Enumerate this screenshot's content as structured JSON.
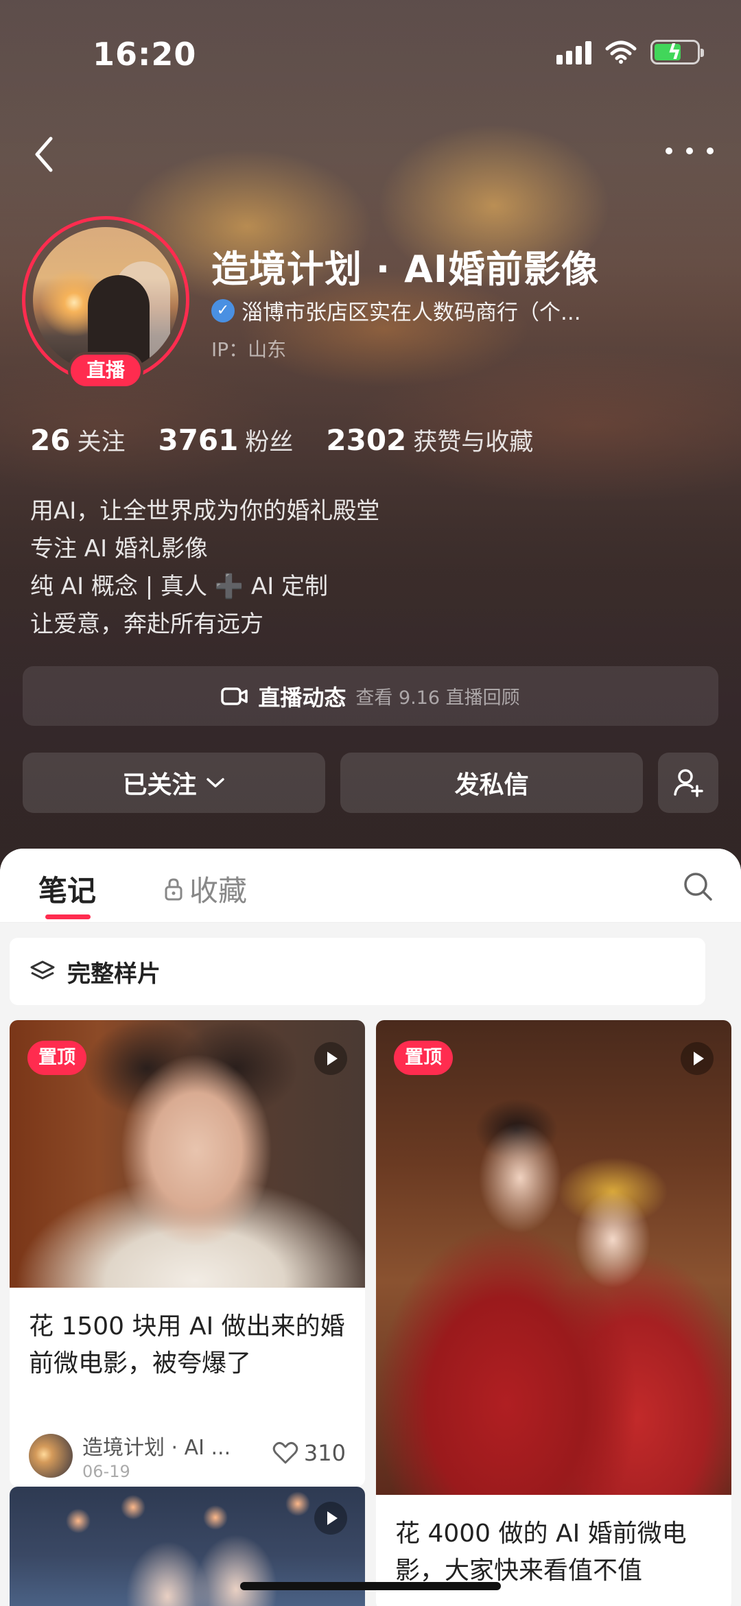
{
  "status_bar": {
    "time": "16:20"
  },
  "profile": {
    "name": "造境计划 · AI婚前影像",
    "verification": "淄博市张店区实在人数码商行（个...",
    "ip": "IP：山东",
    "live_badge": "直播",
    "stats": [
      {
        "num": "26",
        "label": "关注"
      },
      {
        "num": "3761",
        "label": "粉丝"
      },
      {
        "num": "2302",
        "label": "获赞与收藏"
      }
    ],
    "bio": [
      "用AI，让全世界成为你的婚礼殿堂",
      "专注 AI 婚礼影像",
      "纯 AI 概念 | 真人",
      "AI 定制",
      "让爱意，奔赴所有远方"
    ],
    "bio_cross": "➕"
  },
  "live_panel": {
    "title": "直播动态",
    "subtitle": "查看 9.16 直播回顾"
  },
  "actions": {
    "follow": "已关注",
    "message": "发私信"
  },
  "tabs": {
    "notes": "笔记",
    "favorites": "收藏"
  },
  "collection": {
    "label": "完整样片"
  },
  "cards": [
    {
      "pin": "置顶",
      "title_lines": [
        "花 1500 块用 AI 做出来的婚",
        "前微电影，被夸爆了"
      ],
      "author": "造境计划 · AI ...",
      "date": "06-19",
      "likes": "310"
    },
    {
      "pin": "置顶",
      "title_lines": [
        "花 4000 做的 AI 婚前微电",
        "影，大家快来看值不值"
      ]
    }
  ],
  "colors": {
    "accent": "#ff2c4f",
    "verify_blue": "#4a90e2"
  },
  "icons": [
    "back-icon",
    "more-icon",
    "verified-icon",
    "video-camera-icon",
    "chevron-down-icon",
    "add-user-icon",
    "lock-icon",
    "search-icon",
    "layers-icon",
    "play-icon",
    "heart-icon"
  ]
}
